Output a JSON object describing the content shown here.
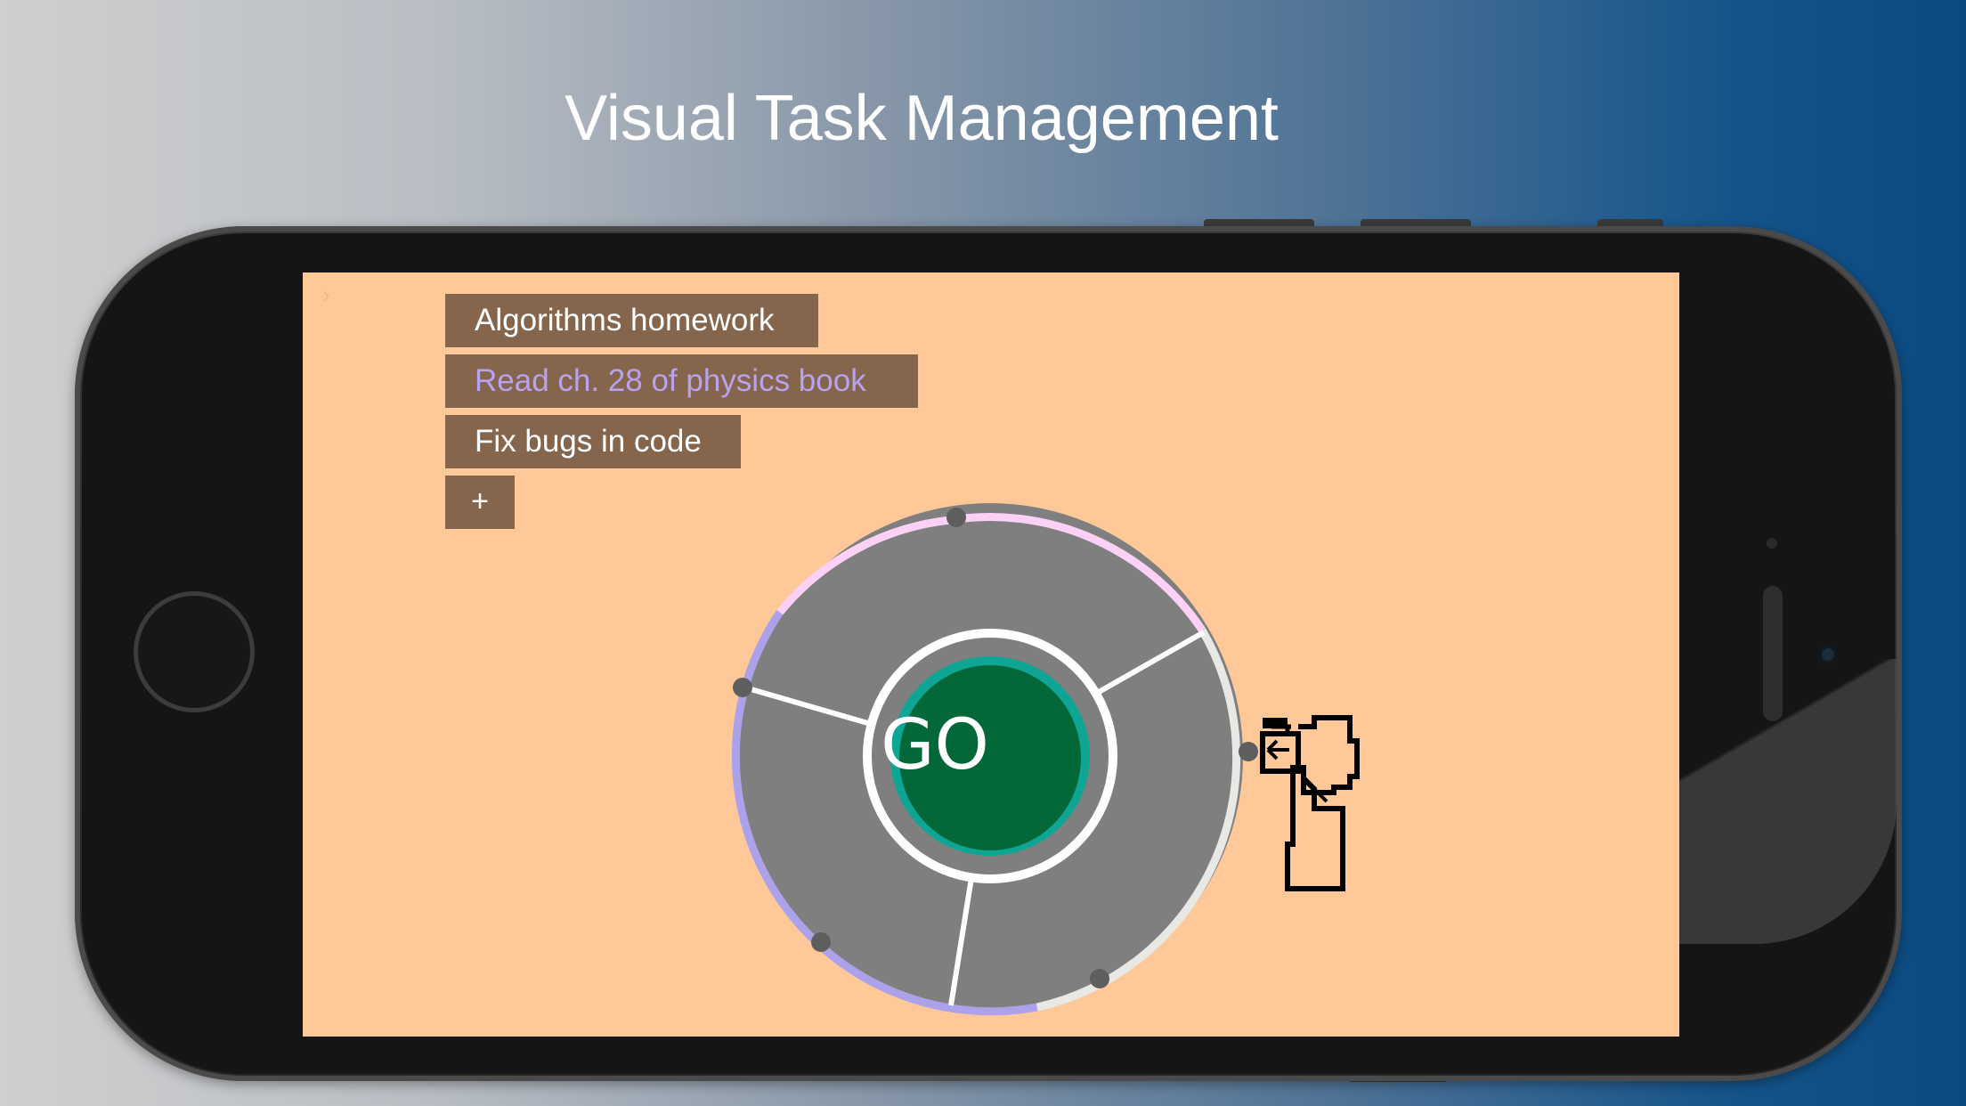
{
  "headline": "Visual Task Management",
  "app": {
    "tasks": [
      {
        "label": "Algorithms homework",
        "color": "#ffffff"
      },
      {
        "label": "Read ch. 28 of physics book",
        "color": "#b9a2ee"
      },
      {
        "label": "Fix bugs in code",
        "color": "#ffffff"
      }
    ],
    "add_label": "+",
    "go_label": "GO"
  },
  "colors": {
    "screen_bg": "#fec898",
    "task_bg": "#85654c",
    "wheel_fill": "#7f7f7f",
    "go_fill": "#036838",
    "go_ring": "#0fa594",
    "segment_pink": "#fdd1f5",
    "segment_purple": "#aca2ea",
    "segment_gray": "#e8e8e4"
  },
  "icons": {
    "back": "chevron-right-icon",
    "timer_hand": "pointing-hand-icon"
  }
}
